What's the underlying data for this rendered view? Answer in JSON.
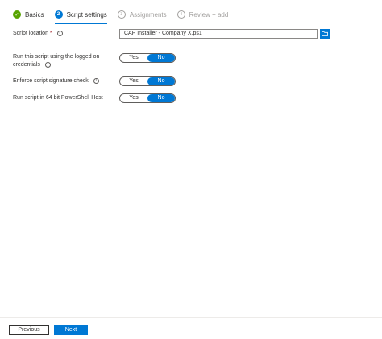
{
  "wizard": {
    "steps": [
      {
        "label": "Basics",
        "marker": "✓"
      },
      {
        "label": "Script settings",
        "marker": "2"
      },
      {
        "label": "Assignments",
        "marker": "3"
      },
      {
        "label": "Review + add",
        "marker": "4"
      }
    ]
  },
  "form": {
    "script_location": {
      "label": "Script location",
      "required_mark": "*",
      "value": "CAP Installer - Company X.ps1"
    },
    "run_logged_on": {
      "label": "Run this script using the logged on credentials",
      "yes": "Yes",
      "no": "No",
      "selected": "No"
    },
    "enforce_signature": {
      "label": "Enforce script signature check",
      "yes": "Yes",
      "no": "No",
      "selected": "No"
    },
    "run_64bit": {
      "label": "Run script in 64 bit PowerShell Host",
      "yes": "Yes",
      "no": "No",
      "selected": "No"
    }
  },
  "footer": {
    "previous_label": "Previous",
    "next_label": "Next"
  },
  "colors": {
    "accent": "#0078d4",
    "done": "#57a300"
  }
}
